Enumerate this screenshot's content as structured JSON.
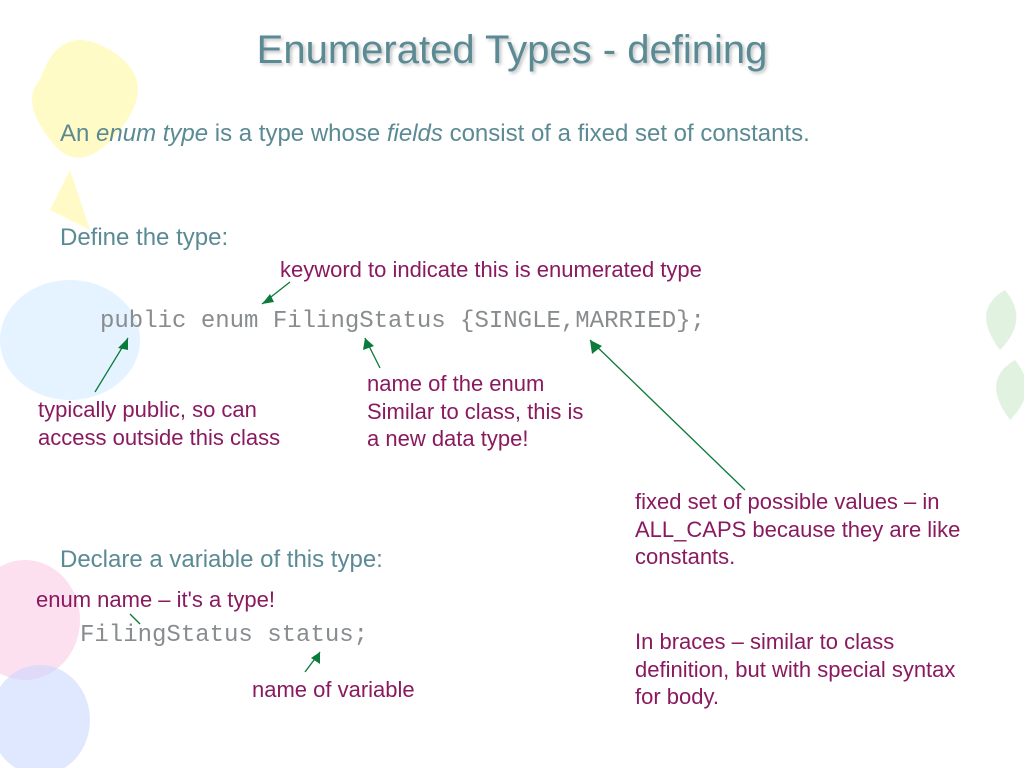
{
  "title": "Enumerated Types - defining",
  "intro": {
    "prefix": "An ",
    "em1": "enum type",
    "mid1": " is a type whose ",
    "em2": "fields",
    "suffix": " consist of a fixed set of constants."
  },
  "section1": {
    "heading": "Define the type:",
    "code": "public enum FilingStatus {SINGLE,MARRIED};"
  },
  "section2": {
    "heading": "Declare a variable of this type:",
    "code": "FilingStatus status;"
  },
  "annot": {
    "keyword": "keyword to indicate this is enumerated type",
    "public": "typically public, so can access outside this class",
    "enum_name": "name of the enum Similar to class, this is a new data type!",
    "fixed_set": "fixed set of possible values – in ALL_CAPS because they are like constants.",
    "braces": "In braces – similar to class definition, but with special syntax for body.",
    "enum_type": "enum name – it's a type!",
    "var_name": "name of variable"
  }
}
